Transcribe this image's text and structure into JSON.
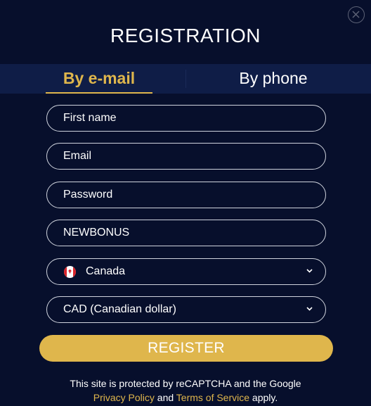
{
  "title": "REGISTRATION",
  "tabs": {
    "email": "By e-mail",
    "phone": "By phone"
  },
  "form": {
    "first_name_placeholder": "First name",
    "email_placeholder": "Email",
    "password_placeholder": "Password",
    "promo_value": "NEWBONUS",
    "country": "Canada",
    "currency": "CAD (Canadian dollar)"
  },
  "register_label": "REGISTER",
  "recaptcha": {
    "line1": "This site is protected by reCAPTCHA and the Google",
    "privacy": "Privacy Policy",
    "and": " and ",
    "terms": "Terms of Service",
    "apply": " apply."
  },
  "icons": {
    "close": "close-icon",
    "chevron": "chevron-down-icon",
    "flag": "canada-flag-icon"
  },
  "colors": {
    "background": "#070f2c",
    "tab_bar": "#0f1d47",
    "accent": "#dfb64c"
  }
}
